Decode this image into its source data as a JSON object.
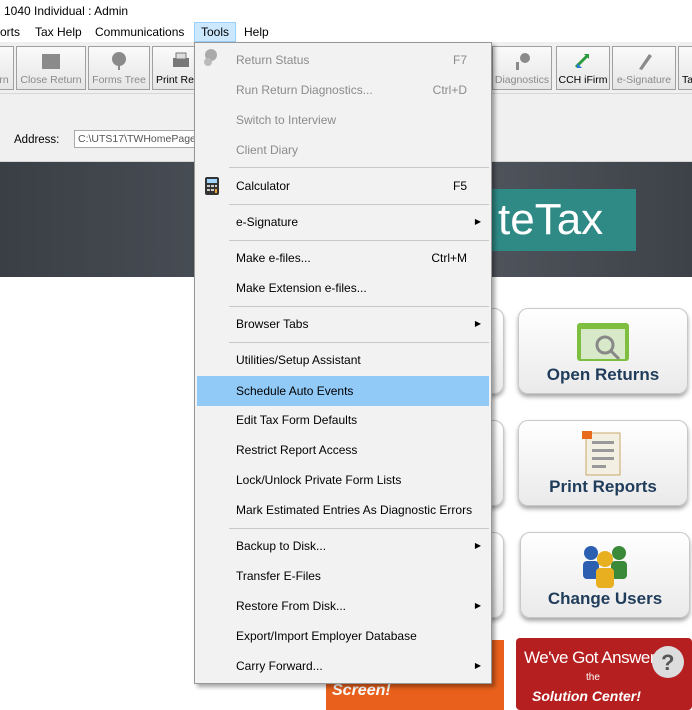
{
  "title": "1040 Individual : Admin",
  "menubar": [
    "orts",
    "Tax Help",
    "Communications",
    "Tools",
    "Help"
  ],
  "toolbar": {
    "close_return": "Close Return",
    "forms_tree": "Forms Tree",
    "print": "Print Re",
    "diagnostics": "Diagnostics",
    "cch_ifirm": "CCH iFirm",
    "esignature": "e-Signature",
    "left_partial": "rn",
    "right_partial": "Ta"
  },
  "address": {
    "label": "Address:",
    "value": "C:\\UTS17\\TWHomePage\\"
  },
  "brand": "teTax",
  "buttons": {
    "open_returns": "Open Returns",
    "print_reports": "Print Reports",
    "change_users": "Change Users"
  },
  "promo": {
    "screen": "Screen!",
    "answers_line1": "We've Got Answers -",
    "answers_line2": "the",
    "answers_line3": "Solution Center!"
  },
  "tools_menu": [
    {
      "label": "Return Status",
      "shortcut": "F7",
      "disabled": true
    },
    {
      "label": "Run Return Diagnostics...",
      "shortcut": "Ctrl+D",
      "disabled": true
    },
    {
      "label": "Switch to Interview",
      "shortcut": "",
      "disabled": true
    },
    {
      "label": "Client Diary",
      "shortcut": "",
      "disabled": true
    },
    {
      "label": "Calculator",
      "shortcut": "F5"
    },
    {
      "label": "e-Signature",
      "shortcut": "",
      "submenu": true
    },
    {
      "label": "Make e-files...",
      "shortcut": "Ctrl+M"
    },
    {
      "label": "Make Extension e-files...",
      "shortcut": ""
    },
    {
      "label": "Browser Tabs",
      "shortcut": "",
      "submenu": true
    },
    {
      "label": "Utilities/Setup Assistant",
      "shortcut": ""
    },
    {
      "label": "Schedule Auto Events",
      "shortcut": "",
      "highlighted": true
    },
    {
      "label": "Edit Tax Form Defaults",
      "shortcut": ""
    },
    {
      "label": "Restrict Report Access",
      "shortcut": ""
    },
    {
      "label": "Lock/Unlock Private Form Lists",
      "shortcut": ""
    },
    {
      "label": "Mark Estimated Entries As Diagnostic Errors",
      "shortcut": ""
    },
    {
      "label": "Backup to Disk...",
      "shortcut": "",
      "submenu": true
    },
    {
      "label": "Transfer E-Files",
      "shortcut": ""
    },
    {
      "label": "Restore From Disk...",
      "shortcut": "",
      "submenu": true
    },
    {
      "label": "Export/Import Employer Database",
      "shortcut": ""
    },
    {
      "label": "Carry Forward...",
      "shortcut": "",
      "submenu": true
    }
  ],
  "colors": {
    "menu_highlight": "#91c9f7",
    "brand_teal": "#2f8a86",
    "active_menu": "#cce8ff"
  }
}
